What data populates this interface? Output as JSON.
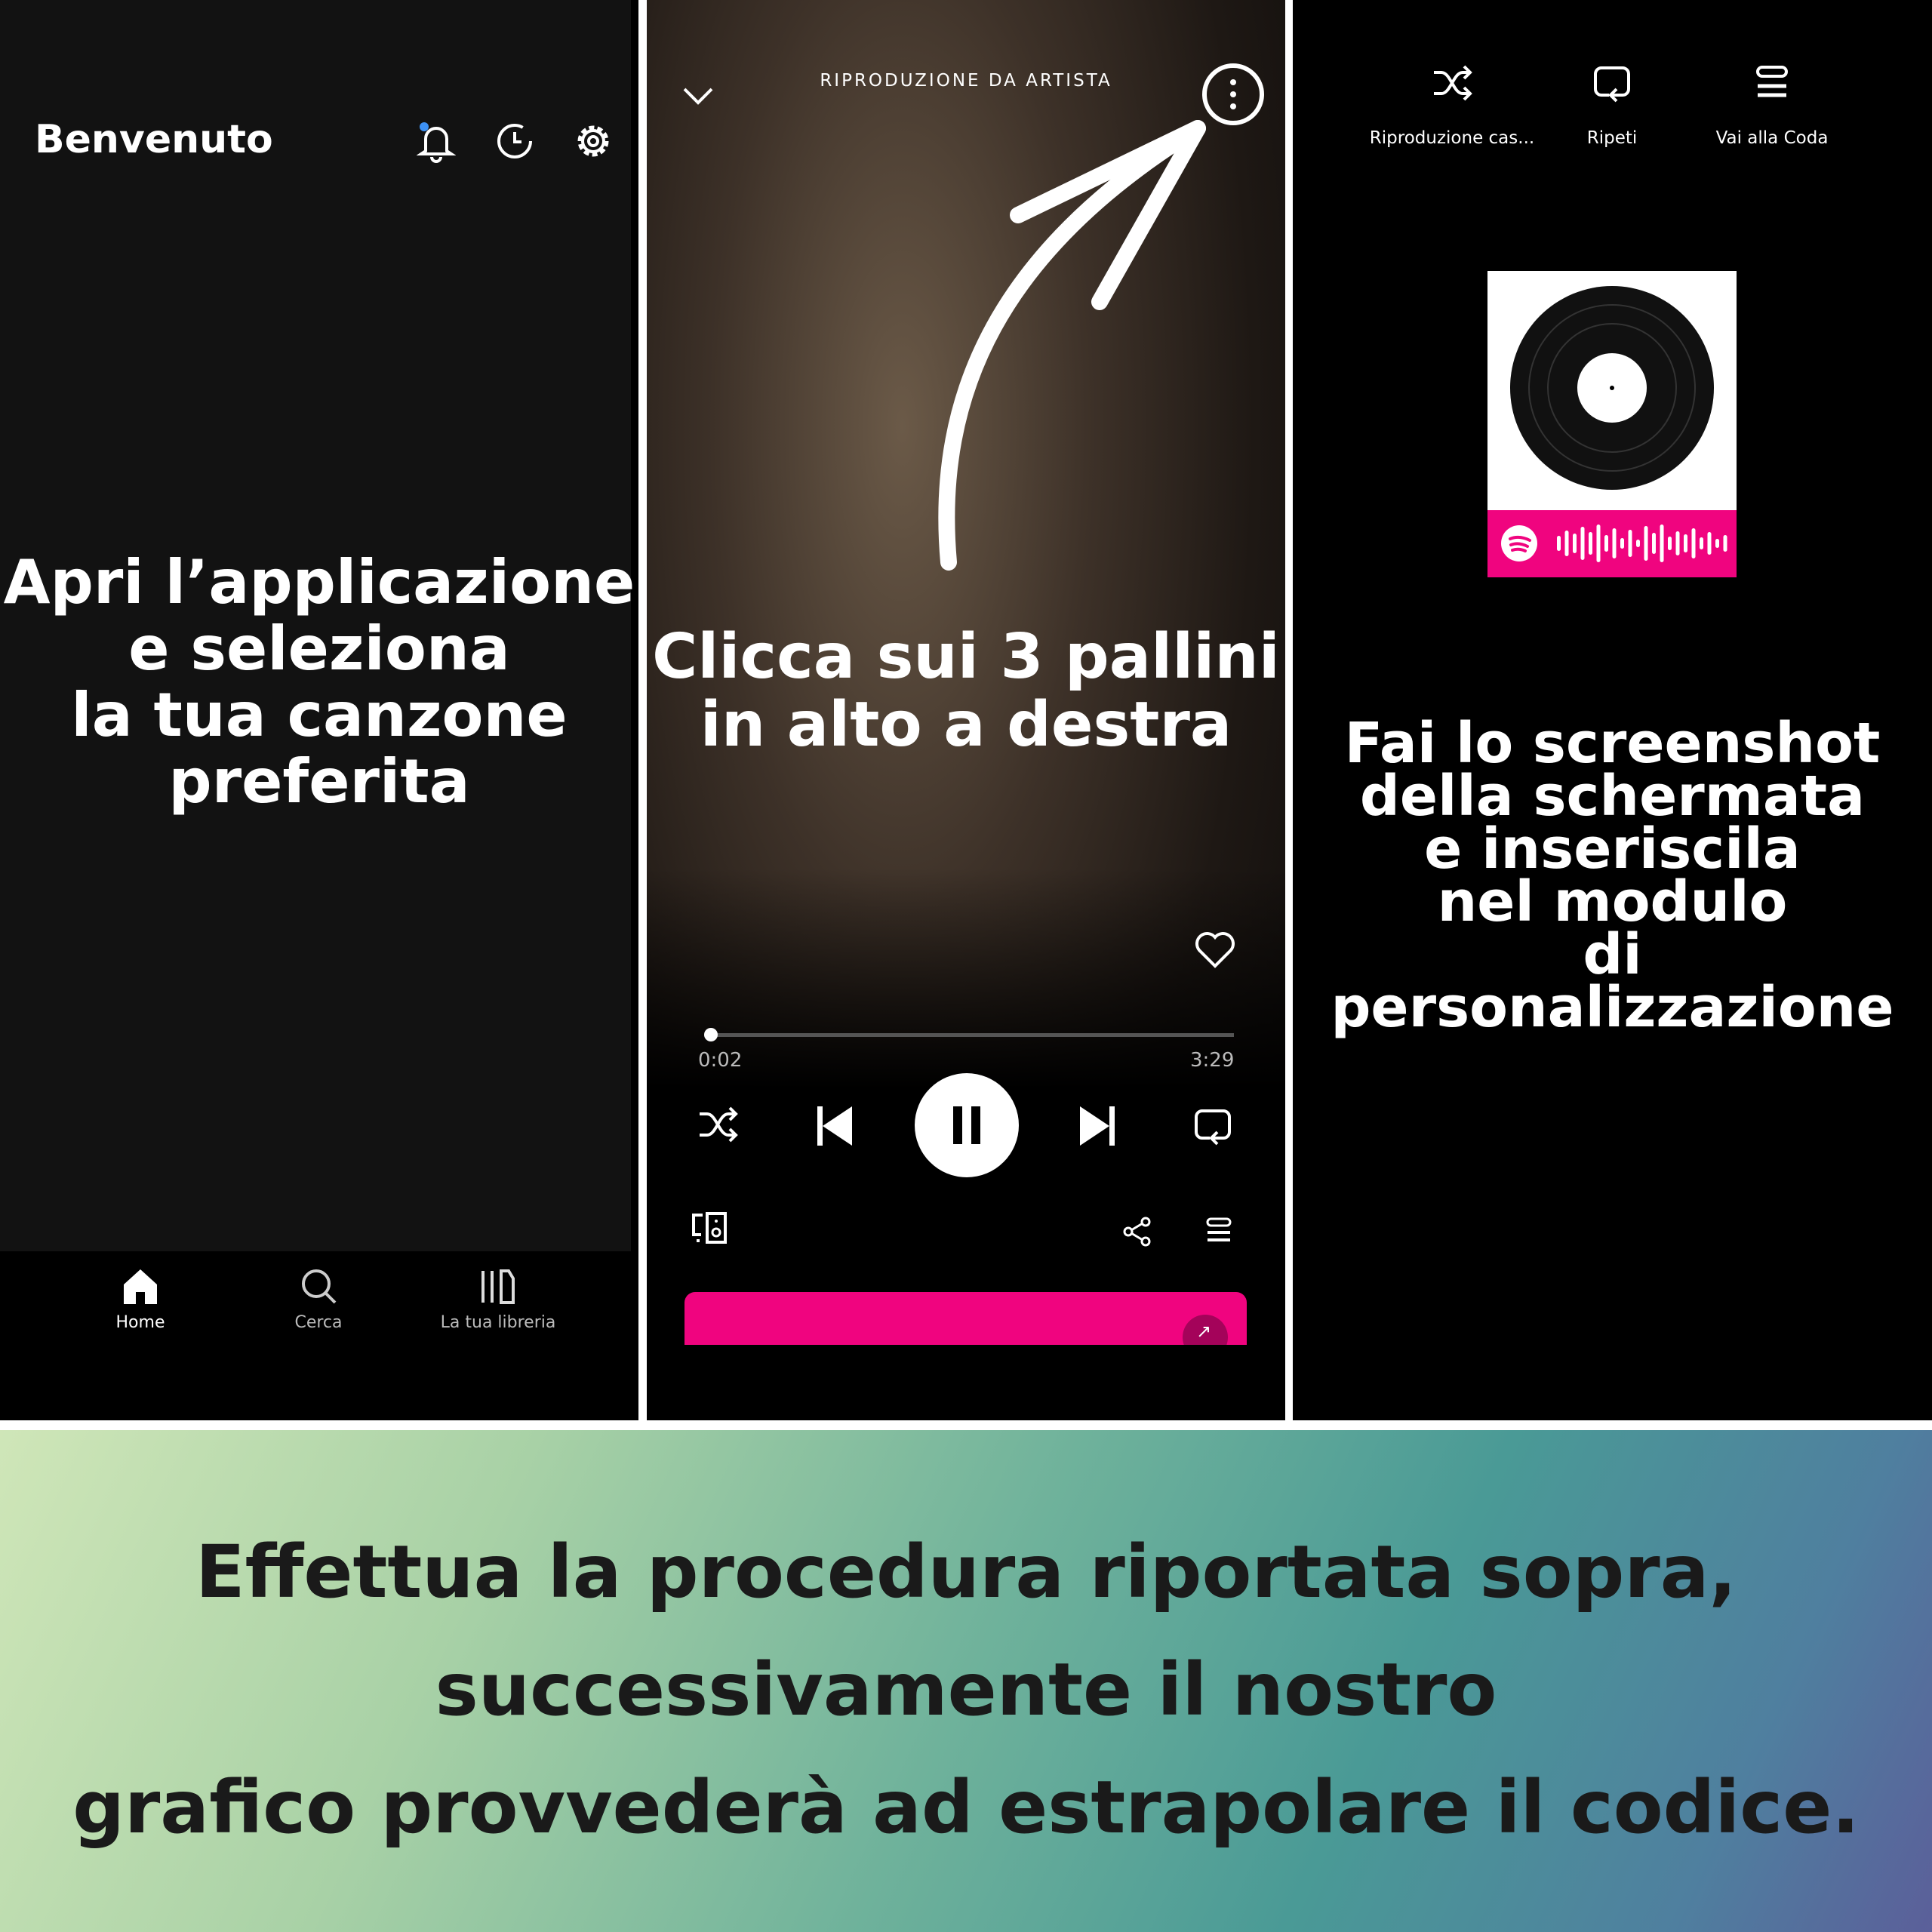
{
  "panel1": {
    "title": "Benvenuto",
    "icons": [
      "bell-icon",
      "history-icon",
      "gear-icon"
    ],
    "instruction": [
      "Apri l’applicazione",
      "e seleziona",
      "la tua canzone",
      "preferita"
    ],
    "nav": [
      {
        "label": "Home",
        "icon": "home-icon"
      },
      {
        "label": "Cerca",
        "icon": "search-icon"
      },
      {
        "label": "La tua libreria",
        "icon": "library-icon"
      }
    ]
  },
  "panel2": {
    "header": "RIPRODUZIONE DA ARTISTA",
    "instruction": [
      "Clicca sui 3 pallini",
      "in alto a destra"
    ],
    "elapsed": "0:02",
    "duration": "3:29",
    "progress_percent": 1,
    "accent": "#f0047f"
  },
  "panel3": {
    "menu": [
      {
        "label": "Riproduzione cas...",
        "icon": "shuffle-icon"
      },
      {
        "label": "Ripeti",
        "icon": "repeat-icon"
      },
      {
        "label": "Vai alla Coda",
        "icon": "queue-icon"
      }
    ],
    "instruction": [
      "Fai lo screenshot",
      "della schermata",
      "e inseriscila",
      "nel modulo",
      "di personalizzazione"
    ],
    "code_color": "#f0047f"
  },
  "bottom": {
    "lines": [
      "Effettua la procedura riportata sopra,",
      "successivamente il nostro",
      "grafico provvederà ad estrapolare il codice."
    ]
  }
}
